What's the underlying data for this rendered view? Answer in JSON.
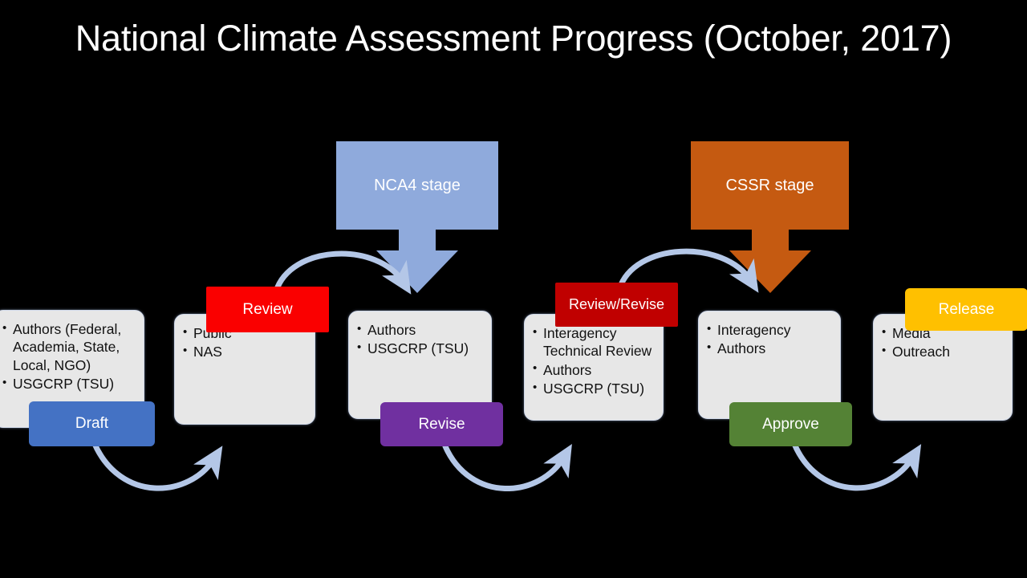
{
  "slide": {
    "background_color": "#000000",
    "title": "National Climate Assessment Progress (October, 2017)"
  },
  "stages": [
    {
      "id": "nca4",
      "label": "NCA4 stage",
      "color": "#8faadc",
      "icon": "down-arrow-block"
    },
    {
      "id": "cssr",
      "label": "CSSR stage",
      "color": "#c55a11",
      "icon": "down-arrow-block"
    }
  ],
  "steps": [
    {
      "id": "draft",
      "items": [
        "Authors (Federal, Academia, State, Local, NGO)",
        "USGCRP (TSU)"
      ],
      "tag": {
        "label": "Draft",
        "color": "#4472c4",
        "position": "bottom"
      }
    },
    {
      "id": "public-review",
      "items": [
        "Public",
        "NAS"
      ],
      "tag": {
        "label": "Review",
        "color": "#fa0000",
        "position": "top"
      }
    },
    {
      "id": "revise",
      "items": [
        "Authors",
        "USGCRP (TSU)"
      ],
      "tag": {
        "label": "Revise",
        "color": "#7030a0",
        "position": "bottom"
      }
    },
    {
      "id": "review-revise",
      "items": [
        "Interagency Technical Review",
        "Authors",
        "USGCRP (TSU)"
      ],
      "tag": {
        "label": "Review/Revise",
        "color": "#c00000",
        "position": "top"
      }
    },
    {
      "id": "approve",
      "items": [
        "Interagency",
        "Authors"
      ],
      "tag": {
        "label": "Approve",
        "color": "#548235",
        "position": "bottom"
      }
    },
    {
      "id": "release",
      "items": [
        "Media",
        "Outreach"
      ],
      "tag": {
        "label": "Release",
        "color": "#ffc000",
        "position": "top"
      }
    }
  ],
  "connectors": {
    "color": "#b4c7e7",
    "icon": "curved-arrow",
    "count": 5
  }
}
